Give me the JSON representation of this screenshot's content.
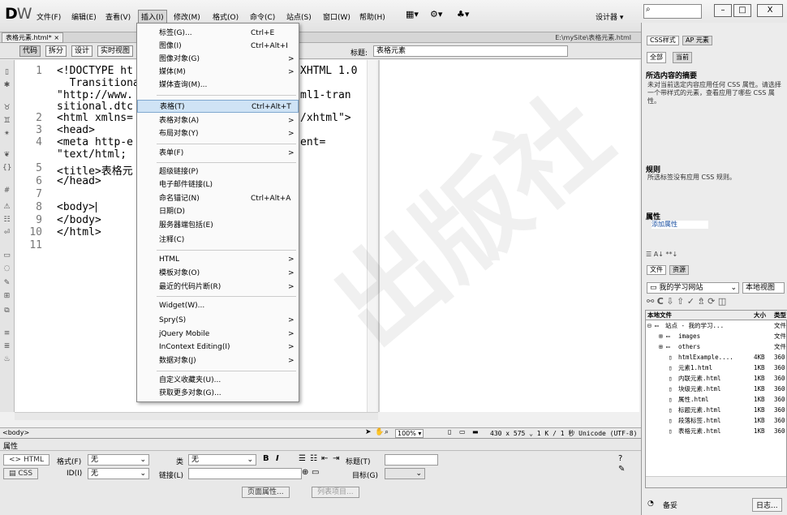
{
  "app": {
    "logo_main": "D",
    "logo_sub": "W"
  },
  "menubar": [
    {
      "label": "文件(F)"
    },
    {
      "label": "编辑(E)"
    },
    {
      "label": "查看(V)"
    },
    {
      "label": "插入(I)"
    },
    {
      "label": "修改(M)"
    },
    {
      "label": "格式(O)"
    },
    {
      "label": "命令(C)"
    },
    {
      "label": "站点(S)"
    },
    {
      "label": "窗口(W)"
    },
    {
      "label": "帮助(H)"
    }
  ],
  "workspace": "设计器",
  "window_buttons": [
    "–",
    "□",
    "X"
  ],
  "document": {
    "tab": "表格元素.html*",
    "tab_close": "×",
    "path": "E:\\mySite\\表格元素.html"
  },
  "views": {
    "code": "代码",
    "split": "拆分",
    "design": "设计",
    "live": "实时视图"
  },
  "title_label": "标题:",
  "title_value": "表格元素",
  "code_lines": [
    {
      "n": "1",
      "t": "<!DOCTYPE ht"
    },
    {
      "n": "",
      "t": "  Transitiona"
    },
    {
      "n": "",
      "t": "\"http://www."
    },
    {
      "n": "",
      "t": "sitional.dtc"
    },
    {
      "n": "2",
      "t": "<html xmlns="
    },
    {
      "n": "3",
      "t": "<head>"
    },
    {
      "n": "4",
      "t": "<meta http-e"
    },
    {
      "n": "",
      "t": "\"text/html;"
    },
    {
      "n": "5",
      "t": "<title>表格元"
    },
    {
      "n": "6",
      "t": "</head>"
    },
    {
      "n": "7",
      "t": ""
    },
    {
      "n": "8",
      "t": "<body>"
    },
    {
      "n": "9",
      "t": "</body>"
    },
    {
      "n": "10",
      "t": "</html>"
    },
    {
      "n": "11",
      "t": ""
    }
  ],
  "code_right": [
    {
      "t": "XHTML 1.0"
    },
    {
      "t": "ml1-tran"
    },
    {
      "t": "/xhtml\">"
    },
    {
      "t": "ent="
    }
  ],
  "insert_menu": [
    {
      "label": "标签(G)...",
      "shortcut": "Ctrl+E",
      "arrow": ""
    },
    {
      "label": "图像(I)",
      "shortcut": "Ctrl+Alt+I",
      "arrow": ""
    },
    {
      "label": "图像对象(G)",
      "shortcut": "",
      "arrow": ">"
    },
    {
      "label": "媒体(M)",
      "shortcut": "",
      "arrow": ">"
    },
    {
      "label": "媒体查询(M)...",
      "shortcut": "",
      "arrow": ""
    },
    {
      "label": "表格(T)",
      "shortcut": "Ctrl+Alt+T",
      "arrow": ""
    },
    {
      "label": "表格对象(A)",
      "shortcut": "",
      "arrow": ">"
    },
    {
      "label": "布局对象(Y)",
      "shortcut": "",
      "arrow": ">"
    },
    {
      "label": "表单(F)",
      "shortcut": "",
      "arrow": ">"
    },
    {
      "label": "超级链接(P)",
      "shortcut": "",
      "arrow": ""
    },
    {
      "label": "电子邮件链接(L)",
      "shortcut": "",
      "arrow": ""
    },
    {
      "label": "命名锚记(N)",
      "shortcut": "Ctrl+Alt+A",
      "arrow": ""
    },
    {
      "label": "日期(D)",
      "shortcut": "",
      "arrow": ""
    },
    {
      "label": "服务器端包括(E)",
      "shortcut": "",
      "arrow": ""
    },
    {
      "label": "注释(C)",
      "shortcut": "",
      "arrow": ""
    },
    {
      "label": "HTML",
      "shortcut": "",
      "arrow": ">"
    },
    {
      "label": "模板对象(O)",
      "shortcut": "",
      "arrow": ">"
    },
    {
      "label": "最近的代码片断(R)",
      "shortcut": "",
      "arrow": ">"
    },
    {
      "label": "Widget(W)...",
      "shortcut": "",
      "arrow": ""
    },
    {
      "label": "Spry(S)",
      "shortcut": "",
      "arrow": ">"
    },
    {
      "label": "jQuery Mobile",
      "shortcut": "",
      "arrow": ">"
    },
    {
      "label": "InContext Editing(I)",
      "shortcut": "",
      "arrow": ">"
    },
    {
      "label": "数据对象(J)",
      "shortcut": "",
      "arrow": ">"
    },
    {
      "label": "自定义收藏夹(U)...",
      "shortcut": "",
      "arrow": ""
    },
    {
      "label": "获取更多对象(G)...",
      "shortcut": "",
      "arrow": ""
    }
  ],
  "status": {
    "tag": "<body>",
    "zoom": "100%",
    "info": "430 x 575 ⌄ 1 K / 1 秒 Unicode (UTF-8)"
  },
  "properties": {
    "title": "属性",
    "html_btn": "HTML",
    "css_btn": "CSS",
    "format_label": "格式(F)",
    "format_value": "无",
    "class_label": "类",
    "class_value": "无",
    "id_label": "ID(I)",
    "id_value": "无",
    "link_label": "链接(L)",
    "title_label": "标题(T)",
    "target_label": "目标(G)",
    "page_props": "页面属性...",
    "list_item": "列表项目..."
  },
  "css_panel": {
    "tab1": "CSS样式",
    "tab2": "AP 元素",
    "all": "全部",
    "current": "当前",
    "summary_head": "所选内容的摘要",
    "summary_text": "未对当前选定内容应用任何 CSS 属性。请选择一个带样式的元素，查看应用了哪些 CSS 属性。",
    "rules_head": "规则",
    "rules_text": "所选标签没有应用 CSS 规则。",
    "props_head": "属性",
    "add_prop": "添加属性"
  },
  "files_panel": {
    "tab1": "文件",
    "tab2": "资源",
    "site": "我的学习网站",
    "view": "本地视图",
    "col_local": "本地文件",
    "col_size": "大小",
    "col_type": "类型",
    "rows": [
      {
        "name": "站点 - 我的学习...",
        "size": "",
        "type": "文件"
      },
      {
        "name": "images",
        "size": "",
        "type": "文件"
      },
      {
        "name": "others",
        "size": "",
        "type": "文件"
      },
      {
        "name": "htmlExample....",
        "size": "4KB",
        "type": "360"
      },
      {
        "name": "元素1.html",
        "size": "1KB",
        "type": "360"
      },
      {
        "name": "内联元素.html",
        "size": "1KB",
        "type": "360"
      },
      {
        "name": "块级元素.html",
        "size": "1KB",
        "type": "360"
      },
      {
        "name": "属性.html",
        "size": "1KB",
        "type": "360"
      },
      {
        "name": "标题元素.html",
        "size": "1KB",
        "type": "360"
      },
      {
        "name": "段落标签.html",
        "size": "1KB",
        "type": "360"
      },
      {
        "name": "表格元素.html",
        "size": "1KB",
        "type": "360"
      }
    ],
    "footer_left": "备妥",
    "footer_right": "日志..."
  },
  "watermark": "出版社"
}
